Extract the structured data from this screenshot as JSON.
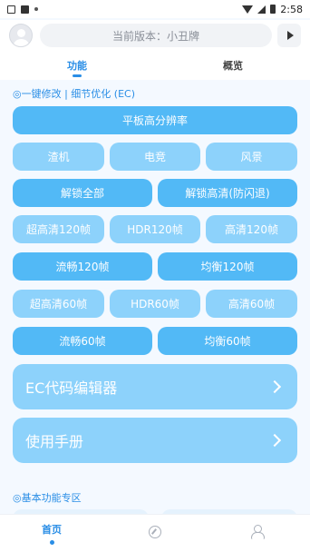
{
  "status_bar": {
    "time": "2:58"
  },
  "header": {
    "version_text": "当前版本：小丑牌"
  },
  "tabs": [
    {
      "label": "功能"
    },
    {
      "label": "概览"
    }
  ],
  "section1": {
    "title": "◎一键修改 | 细节优化 (EC)",
    "rows": [
      [
        "平板高分辨率"
      ],
      [
        "渣机",
        "电竞",
        "风景"
      ],
      [
        "解锁全部",
        "解锁高清(防闪退)"
      ],
      [
        "超高清120帧",
        "HDR120帧",
        "高清120帧"
      ],
      [
        "流畅120帧",
        "均衡120帧"
      ],
      [
        "超高清60帧",
        "HDR60帧",
        "高清60帧"
      ],
      [
        "流畅60帧",
        "均衡60帧"
      ]
    ]
  },
  "cards": [
    {
      "label": "EC代码编辑器"
    },
    {
      "label": "使用手册"
    }
  ],
  "section2": {
    "title": "◎基本功能专区"
  },
  "bottom_nav": {
    "home_label": "首页",
    "icons": [
      "compass-icon",
      "user-icon"
    ]
  },
  "colors": {
    "accent": "#2a8ee6",
    "button_dark": "#52b9f6",
    "button_light": "#8dd2fb"
  }
}
